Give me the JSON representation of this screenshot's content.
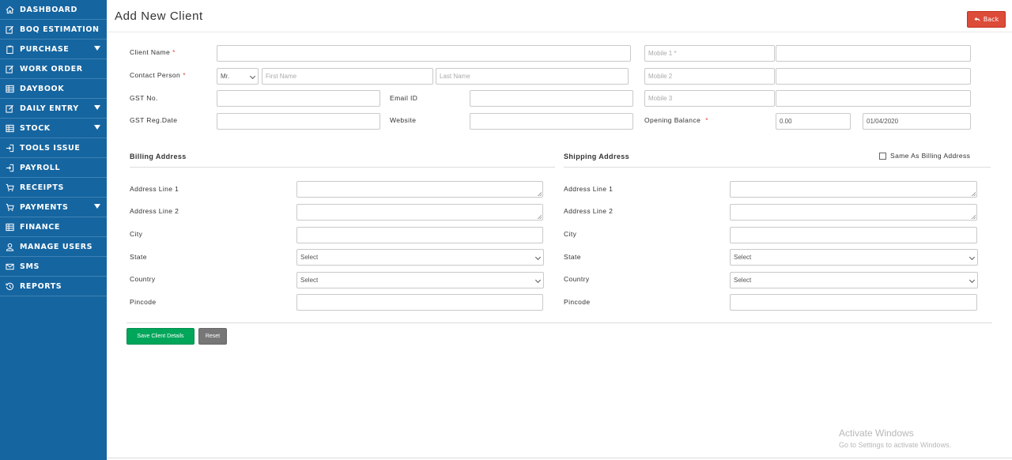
{
  "sidebar": {
    "items": [
      {
        "label": "DASHBOARD",
        "icon": "home-icon"
      },
      {
        "label": "BOQ ESTIMATION",
        "icon": "edit-icon"
      },
      {
        "label": "PURCHASE",
        "icon": "clipboard-icon",
        "dropdown": true
      },
      {
        "label": "WORK ORDER",
        "icon": "edit-icon"
      },
      {
        "label": "DAYBOOK",
        "icon": "table-icon"
      },
      {
        "label": "DAILY ENTRY",
        "icon": "edit-icon",
        "dropdown": true
      },
      {
        "label": "STOCK",
        "icon": "table-icon",
        "dropdown": true
      },
      {
        "label": "TOOLS ISSUE",
        "icon": "sign-in-icon"
      },
      {
        "label": "PAYROLL",
        "icon": "sign-in-icon"
      },
      {
        "label": "RECEIPTS",
        "icon": "cart-icon"
      },
      {
        "label": "PAYMENTS",
        "icon": "cart-icon",
        "dropdown": true
      },
      {
        "label": "FINANCE",
        "icon": "table-icon"
      },
      {
        "label": "MANAGE USERS",
        "icon": "user-icon"
      },
      {
        "label": "SMS",
        "icon": "envelope-icon"
      },
      {
        "label": "REPORTS",
        "icon": "history-icon"
      }
    ]
  },
  "header": {
    "title": "Add New Client",
    "back_label": "Back"
  },
  "client": {
    "client_name_label": "Client Name",
    "contact_person_label": "Contact Person",
    "salutation_value": "Mr.",
    "first_name_placeholder": "First Name",
    "last_name_placeholder": "Last Name",
    "gst_no_label": "GST No.",
    "email_label": "Email ID",
    "gst_reg_date_label": "GST Reg.Date",
    "website_label": "Website",
    "mobile1_placeholder": "Mobile 1 *",
    "mobile2_placeholder": "Mobile 2",
    "mobile3_placeholder": "Mobile 3",
    "opening_balance_label": "Opening Balance",
    "opening_balance_value": "0.00",
    "opening_date_value": "01/04/2020",
    "required_mark": "*"
  },
  "billing": {
    "title": "Billing Address",
    "address1_label": "Address Line 1",
    "address2_label": "Address Line 2",
    "city_label": "City",
    "state_label": "State",
    "state_value": "Select",
    "country_label": "Country",
    "country_value": "Select",
    "pincode_label": "Pincode"
  },
  "shipping": {
    "title": "Shipping Address",
    "same_as_label": "Same As Billing Address",
    "address1_label": "Address Line 1",
    "address2_label": "Address Line 2",
    "city_label": "City",
    "state_label": "State",
    "state_value": "Select",
    "country_label": "Country",
    "country_value": "Select",
    "pincode_label": "Pincode"
  },
  "actions": {
    "save_label": "Save Client Details",
    "reset_label": "Reset"
  },
  "watermark": {
    "line1": "Activate Windows",
    "line2": "Go to Settings to activate Windows."
  },
  "colors": {
    "sidebar": "#1565a0",
    "back_button": "#dd4b39",
    "save_button": "#00a65a",
    "reset_button": "#777777"
  }
}
